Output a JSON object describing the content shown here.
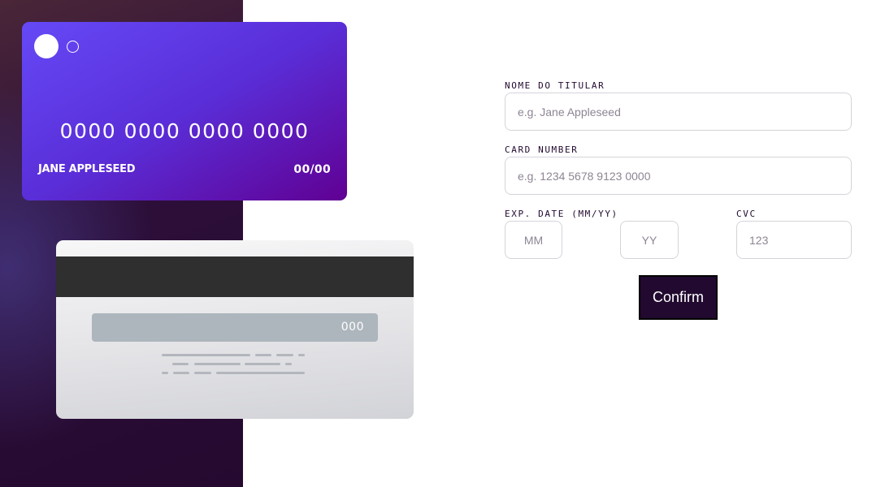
{
  "card_front": {
    "number": "0000 0000 0000 0000",
    "name": "JANE APPLESEED",
    "expiry": "00/00"
  },
  "card_back": {
    "cvc": "000"
  },
  "form": {
    "name_label": "NOME DO TITULAR",
    "name_placeholder": "e.g. Jane Appleseed",
    "number_label": "CARD NUMBER",
    "number_placeholder": "e.g. 1234 5678 9123 0000",
    "expiry_label": "EXP. DATE (MM/YY)",
    "month_placeholder": "MM",
    "year_placeholder": "YY",
    "cvc_label": "CVC",
    "cvc_placeholder": "123",
    "confirm_label": "Confirm"
  },
  "colors": {
    "card_gradient_start": "#6549f6",
    "card_gradient_end": "#600093",
    "dark_violet": "#21092f",
    "input_border": "#d6d3da"
  }
}
